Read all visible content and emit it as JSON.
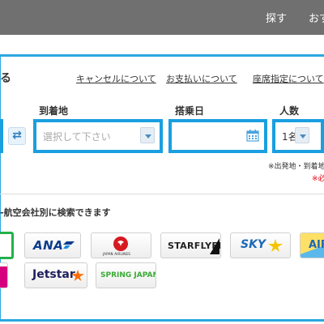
{
  "header": {
    "nav": [
      "探す",
      "おす"
    ]
  },
  "search": {
    "heading_fragment": "る",
    "links": {
      "cancel": "キャンセルについて",
      "payment": "お支払いについて",
      "seat": "座席指定について"
    },
    "labels": {
      "arrival": "到着地",
      "date": "搭乗日",
      "passengers": "人数"
    },
    "arrival_placeholder": "選択して下さい",
    "passengers_value": "1名",
    "note": "※出発地・到着地",
    "note_required": "※必"
  },
  "airlines": {
    "heading": "-航空会社別に検索できます",
    "logos": {
      "ana": "ANA",
      "jal_sub": "JAPAN AIRLINES",
      "starflyer": "STARFLYER",
      "skymark": "SKY",
      "airdo": "AIR",
      "jetstar": "Jetstar",
      "spring": "SPRING JAPAN"
    }
  },
  "colors": {
    "accent": "#1a9fe0",
    "topbar": "#707070",
    "selected": "#22b14c",
    "required": "#e60012"
  }
}
